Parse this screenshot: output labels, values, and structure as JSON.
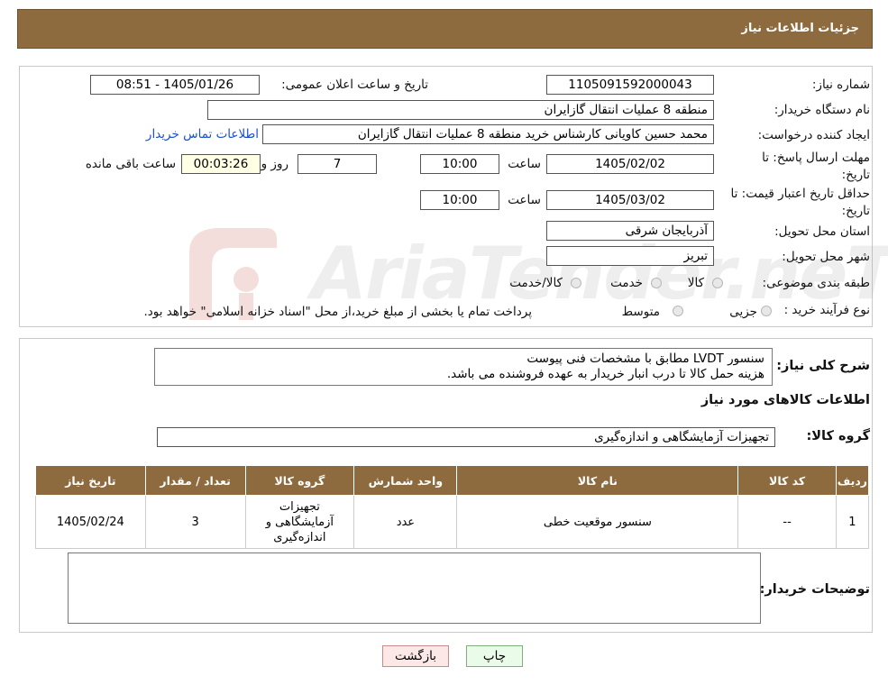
{
  "header": {
    "title": "جزئیات اطلاعات نیاز"
  },
  "form": {
    "need_number_label": "شماره نیاز:",
    "need_number": "1105091592000043",
    "announce_label": "تاریخ و ساعت اعلان عمومی:",
    "announce_value": "1405/01/26 - 08:51",
    "buyer_org_label": "نام دستگاه خریدار:",
    "buyer_org": "منطقه 8 عملیات انتقال گازایران",
    "creator_label": "ایجاد کننده درخواست:",
    "creator": "محمد حسین کاویانی کارشناس خرید منطقه 8 عملیات انتقال گازایران",
    "contact_link": "اطلاعات تماس خریدار",
    "deadline_label_1": "مهلت ارسال پاسخ: تا",
    "deadline_label_2": "تاریخ:",
    "deadline_date": "1405/02/02",
    "time_label": "ساعت",
    "deadline_time": "10:00",
    "days_value": "7",
    "days_label": "روز و",
    "remaining_time": "00:03:26",
    "remaining_label": "ساعت باقی مانده",
    "validity_label_1": "حداقل تاریخ اعتبار قیمت: تا",
    "validity_label_2": "تاریخ:",
    "validity_date": "1405/03/02",
    "validity_time_label": "ساعت",
    "validity_time": "10:00",
    "province_label": "استان محل تحویل:",
    "province": "آذربایجان شرقی",
    "city_label": "شهر محل تحویل:",
    "city": "تبریز",
    "category_label": "طبقه بندی موضوعی:",
    "category_options": [
      "کالا",
      "خدمت",
      "کالا/خدمت"
    ],
    "process_label": "نوع فرآیند خرید :",
    "process_options": [
      "جزیی",
      "متوسط"
    ],
    "process_note": "پرداخت تمام یا بخشی از مبلغ خرید،از محل \"اسناد خزانه اسلامی\" خواهد بود."
  },
  "description": {
    "label": "شرح کلی نیاز:",
    "line1": "سنسور  LVDT  مطابق با مشخصات فنی پیوست",
    "line2": "هزینه حمل کالا تا درب انبار خریدار به عهده فروشنده می باشد."
  },
  "goods": {
    "section_title": "اطلاعات کالاهای مورد نیاز",
    "group_label": "گروه کالا:",
    "group_value": "تجهیزات آزمایشگاهی و اندازه‌گیری"
  },
  "table": {
    "headers": [
      "ردیف",
      "کد کالا",
      "نام کالا",
      "واحد شمارش",
      "گروه کالا",
      "تعداد / مقدار",
      "تاریخ نیاز"
    ],
    "rows": [
      [
        "1",
        "--",
        "سنسور موقعیت خطی",
        "عدد",
        "تجهیزات آزمایشگاهی و اندازه‌گیری",
        "3",
        "1405/02/24"
      ]
    ]
  },
  "notes": {
    "label": "توضیحات خریدار:",
    "value": ""
  },
  "buttons": {
    "print": "چاپ",
    "back": "بازگشت"
  },
  "colors": {
    "header_bg": "#8d6b3f",
    "link": "#1a4fd4",
    "back_btn_bg": "#fde8e8",
    "print_btn_bg": "#eafbe9"
  }
}
